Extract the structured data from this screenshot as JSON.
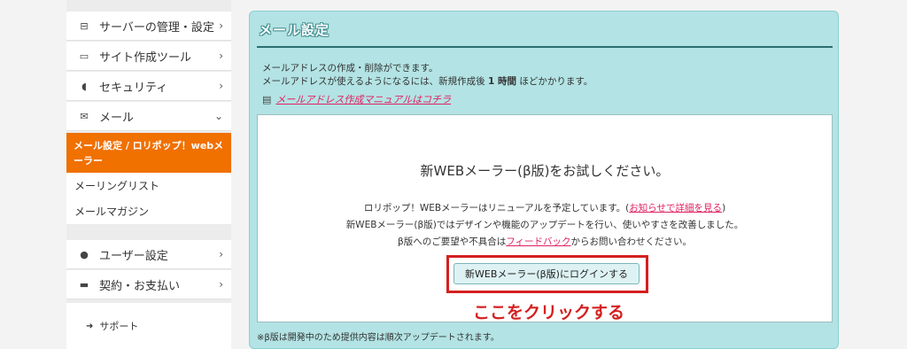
{
  "sidebar": {
    "items": [
      {
        "icon": "server-icon",
        "glyph": "⊟",
        "label": "サーバーの管理・設定",
        "chevron": "›"
      },
      {
        "icon": "laptop-icon",
        "glyph": "▭",
        "label": "サイト作成ツール",
        "chevron": "›"
      },
      {
        "icon": "shield-icon",
        "glyph": "◖",
        "label": "セキュリティ",
        "chevron": "›"
      },
      {
        "icon": "mail-icon",
        "glyph": "✉",
        "label": "メール",
        "chevron": "⌄"
      }
    ],
    "active_sub": "メール設定 / ロリポップ！webメーラー",
    "sub_items": [
      "メーリングリスト",
      "メールマガジン"
    ],
    "items2": [
      {
        "icon": "user-icon",
        "glyph": "●",
        "label": "ユーザー設定",
        "chevron": "›"
      },
      {
        "icon": "card-icon",
        "glyph": "▬",
        "label": "契約・お支払い",
        "chevron": "›"
      }
    ],
    "support": {
      "glyph": "➜",
      "label": "サポート"
    }
  },
  "panel": {
    "title": "メール設定",
    "desc1": "メールアドレスの作成・削除ができます。",
    "desc2_pre": "メールアドレスが使えるようになるには、新規作成後 ",
    "desc2_bold": "1 時間",
    "desc2_post": " ほどかかります。",
    "manual_icon": "▤",
    "manual_link": "メールアドレス作成マニュアルはコチラ"
  },
  "promo": {
    "headline": "新WEBメーラー(β版)をお試しください。",
    "line1_pre": "ロリポップ！WEBメーラーはリニューアルを予定しています。(",
    "line1_link": "お知らせで詳細を見る",
    "line1_post": ")",
    "line2": "新WEBメーラー(β版)ではデザインや機能のアップデートを行い、使いやすさを改善しました。",
    "line3_pre": "β版へのご要望や不具合は",
    "line3_link": "フィードバック",
    "line3_post": "からお問い合わせください。",
    "login_button": "新WEBメーラー(β版)にログインする",
    "annotation": "ここをクリックする",
    "accent": "#d42020"
  },
  "footnote": "※β版は開発中のため提供内容は順次アップデートされます。"
}
